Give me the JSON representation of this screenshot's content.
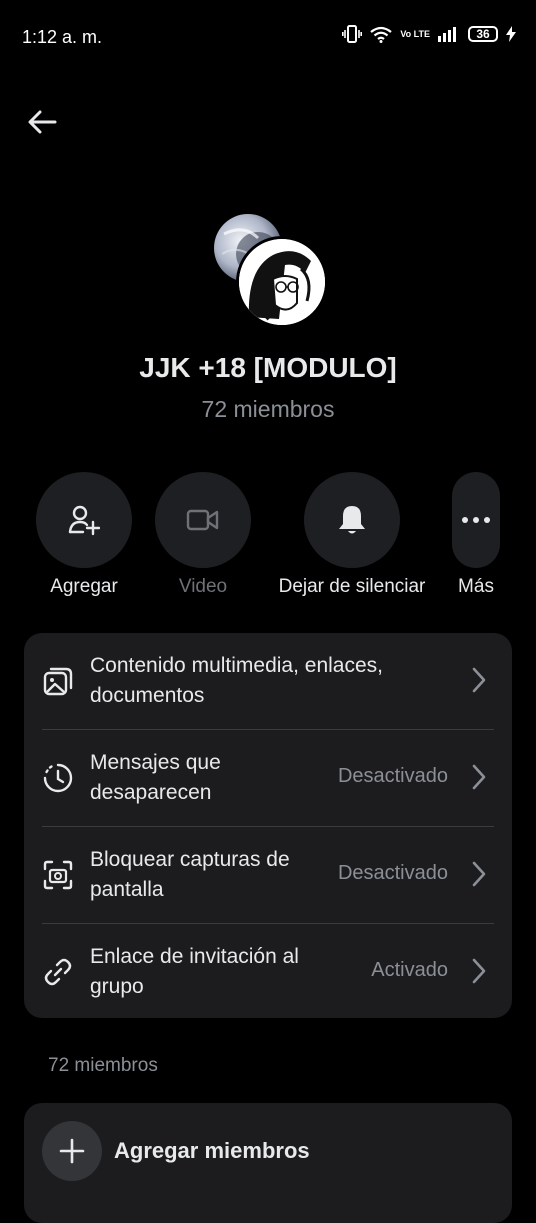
{
  "status_bar": {
    "time": "1:12 a. m.",
    "battery": "36",
    "network": "Vo LTE"
  },
  "header": {
    "back_icon": "arrow-left-icon"
  },
  "group": {
    "name": "JJK +18 [MODULO]",
    "member_count": "72 miembros"
  },
  "actions": [
    {
      "label": "Agregar",
      "icon": "add-user-icon"
    },
    {
      "label": "Video",
      "icon": "video-camera-icon"
    },
    {
      "label": "Dejar de silenciar",
      "icon": "bell-icon"
    },
    {
      "label": "Más",
      "icon": "more-icon"
    }
  ],
  "settings": [
    {
      "title": "Contenido multimedia, enlaces, documentos",
      "status": "",
      "icon": "media-icon"
    },
    {
      "title": "Mensajes que desaparecen",
      "status": "Desactivado",
      "icon": "timer-icon"
    },
    {
      "title": "Bloquear capturas de pantalla",
      "status": "Desactivado",
      "icon": "screenshot-icon"
    },
    {
      "title": "Enlace de invitación al grupo",
      "status": "Activado",
      "icon": "link-icon"
    }
  ],
  "members_section": {
    "label": "72 miembros",
    "add_label": "Agregar miembros"
  },
  "colors": {
    "background": "#000000",
    "card": "#1c1c1f",
    "text": "#e7e9ea",
    "muted": "#8b8f96"
  }
}
